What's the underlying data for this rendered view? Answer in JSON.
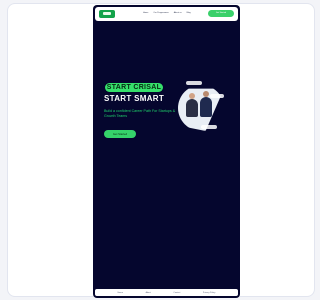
{
  "preview": {
    "nav": {
      "logo": "CENTRE",
      "items": [
        "Home",
        "Our Programmes",
        "About us",
        "Blog"
      ],
      "cta": "Get Started"
    },
    "hero": {
      "badge": "START CRISAL",
      "title": "START SMART",
      "subtitle": "Build a confident Career Path For Startups & Growth Teams",
      "cta": "Get Started"
    },
    "photo": {
      "alt_icon": "team-photo"
    },
    "footer": {
      "items": [
        "Home",
        "About",
        "Contact",
        "Privacy Policy"
      ]
    }
  }
}
